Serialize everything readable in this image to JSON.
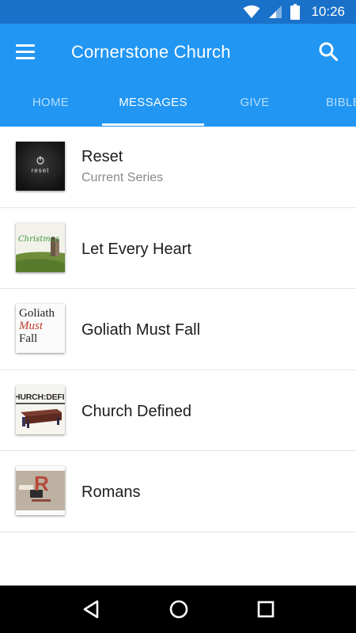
{
  "status_bar": {
    "time": "10:26"
  },
  "app_bar": {
    "title": "Cornerstone Church"
  },
  "tabs": [
    {
      "label": "HOME"
    },
    {
      "label": "MESSAGES",
      "active": true
    },
    {
      "label": "GIVE"
    },
    {
      "label": "BIBLE"
    }
  ],
  "series": [
    {
      "title": "Reset",
      "subtitle": "Current Series",
      "thumb_text": "reset"
    },
    {
      "title": "Let Every Heart",
      "thumb_text": "Christmas"
    },
    {
      "title": "Goliath Must Fall",
      "thumb_lines": [
        "Goliath",
        "Must",
        "Fall"
      ]
    },
    {
      "title": "Church Defined",
      "thumb_text": "HURCH:DEFINE"
    },
    {
      "title": "Romans",
      "thumb_text": "R"
    }
  ],
  "colors": {
    "status_bar": "#1a71c9",
    "app_bar": "#2196f3",
    "nav_bar": "#000000"
  }
}
